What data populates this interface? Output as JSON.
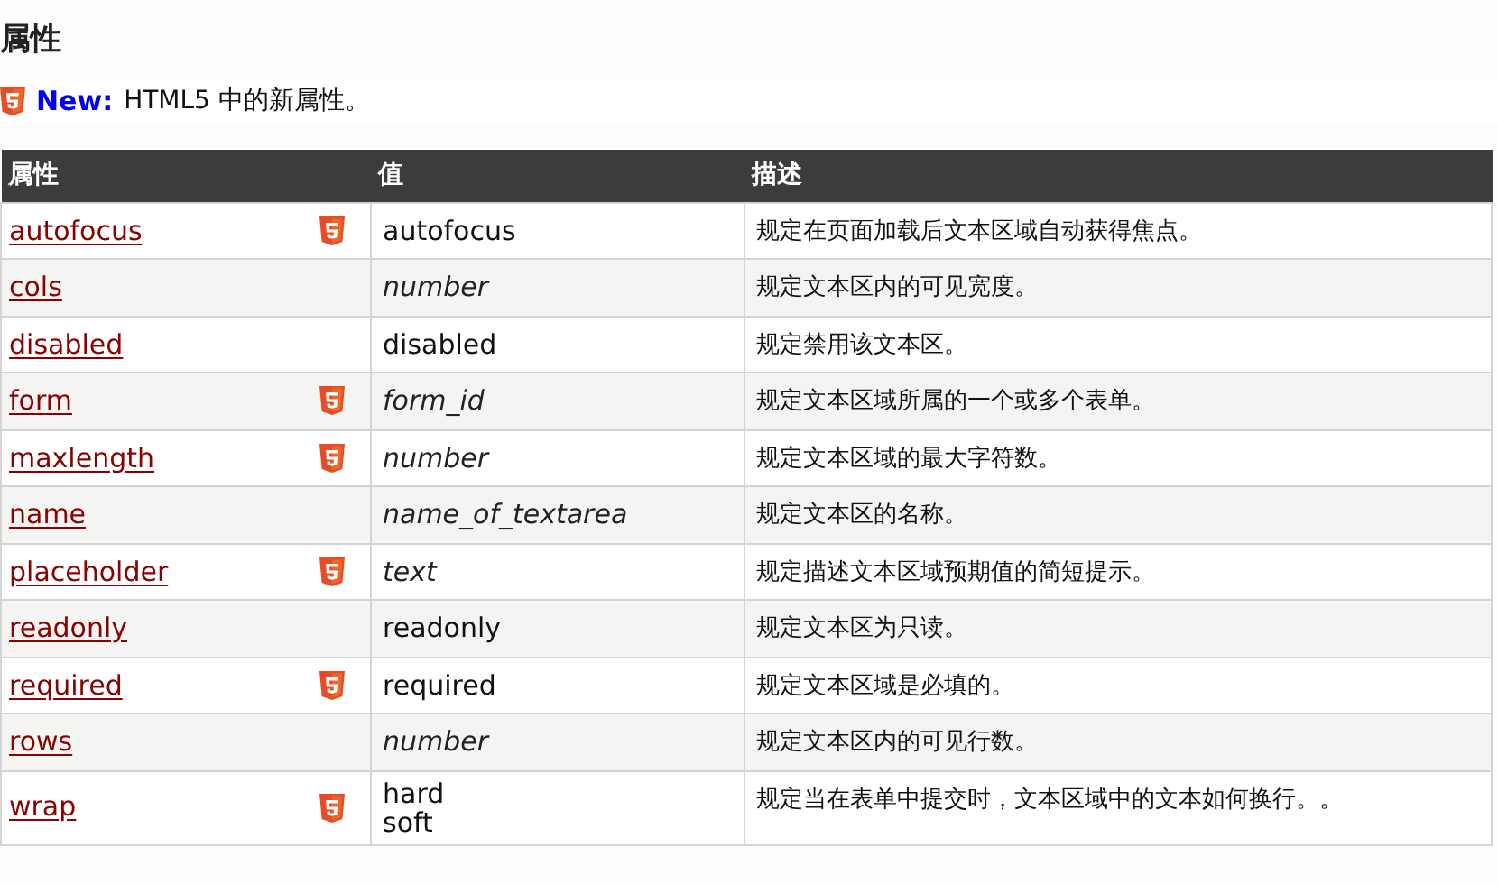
{
  "heading": "属性",
  "note": {
    "label": "New:",
    "text": "HTML5 中的新属性。"
  },
  "table": {
    "columns": [
      "属性",
      "值",
      "描述"
    ],
    "rows": [
      {
        "attribute": "autofocus",
        "html5": true,
        "values": [
          "autofocus"
        ],
        "italic": false,
        "description": "规定在页面加载后文本区域自动获得焦点。"
      },
      {
        "attribute": "cols",
        "html5": false,
        "values": [
          "number"
        ],
        "italic": true,
        "description": "规定文本区内的可见宽度。"
      },
      {
        "attribute": "disabled",
        "html5": false,
        "values": [
          "disabled"
        ],
        "italic": false,
        "description": "规定禁用该文本区。"
      },
      {
        "attribute": "form",
        "html5": true,
        "values": [
          "form_id"
        ],
        "italic": true,
        "description": "规定文本区域所属的一个或多个表单。"
      },
      {
        "attribute": "maxlength",
        "html5": true,
        "values": [
          "number"
        ],
        "italic": true,
        "description": "规定文本区域的最大字符数。"
      },
      {
        "attribute": "name",
        "html5": false,
        "values": [
          "name_of_textarea"
        ],
        "italic": true,
        "description": "规定文本区的名称。"
      },
      {
        "attribute": "placeholder",
        "html5": true,
        "values": [
          "text"
        ],
        "italic": true,
        "description": "规定描述文本区域预期值的简短提示。"
      },
      {
        "attribute": "readonly",
        "html5": false,
        "values": [
          "readonly"
        ],
        "italic": false,
        "description": "规定文本区为只读。"
      },
      {
        "attribute": "required",
        "html5": true,
        "values": [
          "required"
        ],
        "italic": false,
        "description": "规定文本区域是必填的。"
      },
      {
        "attribute": "rows",
        "html5": false,
        "values": [
          "number"
        ],
        "italic": true,
        "description": "规定文本区内的可见行数。"
      },
      {
        "attribute": "wrap",
        "html5": true,
        "values": [
          "hard",
          "soft"
        ],
        "italic": false,
        "description": "规定当在表单中提交时，文本区域中的文本如何换行。。"
      }
    ]
  }
}
